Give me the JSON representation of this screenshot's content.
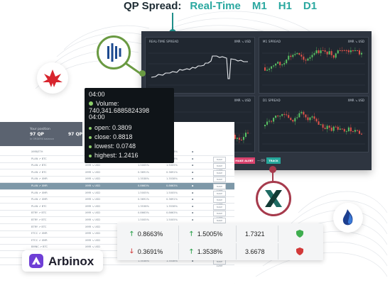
{
  "header": {
    "lead": "QP Spread:",
    "options": [
      "Real-Time",
      "M1",
      "H1",
      "D1"
    ]
  },
  "panels": [
    {
      "title": "REAL-TIME SPREAD",
      "pair": "XMR ↘ USD"
    },
    {
      "title": "M1 SPREAD",
      "pair": "XMR ↘ USD"
    },
    {
      "title": "",
      "pair": "XMR ↘ USD"
    },
    {
      "title": "D1 SPREAD",
      "pair": "XMR ↘ USD"
    }
  ],
  "actions": {
    "make_alert": "MAKE ALERT",
    "or": "— OR —",
    "track": "TRACK"
  },
  "tooltip": {
    "time1": "04:00",
    "volume": "Volume: 740,341.6885824398",
    "time2": "04:00",
    "open": "open: 0.3809",
    "close": "close: 0.8818",
    "lowest": "lowest: 0.0748",
    "highest": "highest: 1.2416"
  },
  "left_table": {
    "summary_caption": "Your position",
    "summary_value": "97 QP",
    "summary_note": "in ORDERS balance",
    "summary_value2": "97 QP",
    "rows": [
      {
        "pair": "XMR/ETH",
        "rate": "",
        "change": "",
        "highlight": false
      },
      {
        "pair": "PLAN ↗ BTC",
        "rate": "XMR ↘ USD",
        "change": "0.8663%",
        "highlight": false
      },
      {
        "pair": "PLAN ↗ BTC",
        "rate": "XMR ↘ USD",
        "change": "1.5005%",
        "highlight": false
      },
      {
        "pair": "PLAN ↗ BTC",
        "rate": "XMR ↘ USD",
        "change": "0.3691%",
        "highlight": false
      },
      {
        "pair": "PLAN ↗ XMR",
        "rate": "XMR ↘ USD",
        "change": "1.3538%",
        "highlight": false
      },
      {
        "pair": "PLAN ↗ XMR",
        "rate": "XMR ↘ USD",
        "change": "0.8663%",
        "highlight": true
      },
      {
        "pair": "PLAN ↗ XMR",
        "rate": "XMR ↘ USD",
        "change": "1.5005%",
        "highlight": false
      },
      {
        "pair": "PLAN ↗ XMR",
        "rate": "XMR ↘ USD",
        "change": "0.3691%",
        "highlight": false
      },
      {
        "pair": "PLAN ↗ BTC",
        "rate": "XMR ↘ USD",
        "change": "1.3538%",
        "highlight": false
      },
      {
        "pair": "BTRY ↗ BTC",
        "rate": "XMR ↘ USD",
        "change": "0.8663%",
        "highlight": false
      },
      {
        "pair": "BTRY ↗ BTC",
        "rate": "XMR ↘ USD",
        "change": "1.5005%",
        "highlight": false
      },
      {
        "pair": "BTRY ↗ BTC",
        "rate": "XMR ↘ USD",
        "change": "0.3691%",
        "highlight": false
      },
      {
        "pair": "ETCC ↗ XMR",
        "rate": "XMR ↘ USD",
        "change": "1.3538%",
        "highlight": false
      },
      {
        "pair": "ETCC ↗ XMR",
        "rate": "XMR ↘ USD",
        "change": "0.8663%",
        "highlight": false
      },
      {
        "pair": "BMNC ↗ BTC",
        "rate": "XMR ↘ USD",
        "change": "1.5005%",
        "highlight": false
      },
      {
        "pair": "BMNC ↗ BTC",
        "rate": "XMR ↘ USD",
        "change": "0.3691%",
        "highlight": false
      },
      {
        "pair": "BMNC ↗ BTC",
        "rate": "XMR ↘ USD",
        "change": "1.3538%",
        "highlight": false
      }
    ],
    "button_label": "MAKE ALERT"
  },
  "rates_table": {
    "rows": [
      {
        "dir1": "up",
        "v1": "0.8663%",
        "dir2": "up",
        "v2": "1.5005%",
        "v3": "1.7321",
        "status": "green"
      },
      {
        "dir1": "down",
        "v1": "0.3691%",
        "dir2": "up",
        "v2": "1.3538%",
        "v3": "3.6678",
        "status": "red"
      }
    ]
  },
  "brand": {
    "name": "Arbinox"
  },
  "colors": {
    "teal": "#2aa8a0",
    "green": "#6a9a42",
    "crimson": "#a63a4c",
    "dark": "#2e3540",
    "alert": "#d9426d"
  }
}
